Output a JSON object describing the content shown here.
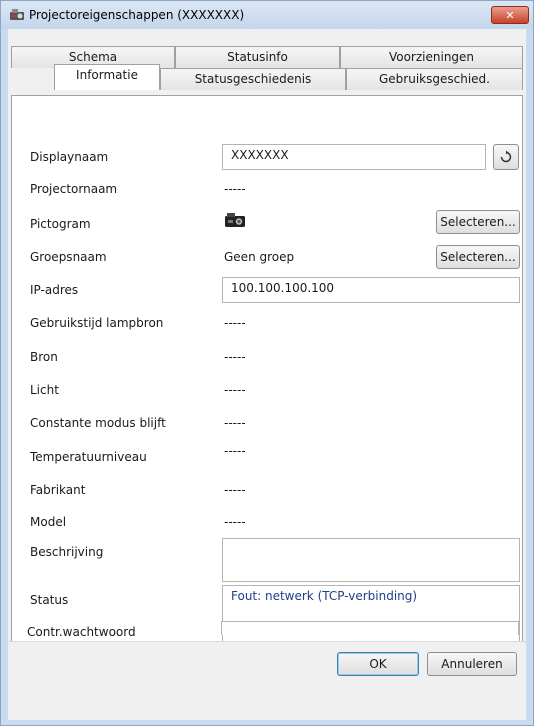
{
  "window": {
    "title": "Projectoreigenschappen (XXXXXXX)",
    "close_label": "✕"
  },
  "tabs_row1": [
    "Schema",
    "Statusinfo",
    "Voorzieningen"
  ],
  "tabs_row2": [
    "Informatie",
    "Statusgeschiedenis",
    "Gebruiksgeschied."
  ],
  "fields": {
    "displaynaam": {
      "label": "Displaynaam",
      "value": "XXXXXXX"
    },
    "projectornaam": {
      "label": "Projectornaam",
      "value": "-----"
    },
    "pictogram": {
      "label": "Pictogram",
      "button": "Selecteren..."
    },
    "groepsnaam": {
      "label": "Groepsnaam",
      "value": "Geen groep",
      "button": "Selecteren..."
    },
    "ip": {
      "label": "IP-adres",
      "value": "100.100.100.100"
    },
    "lamp": {
      "label": "Gebruikstijd lampbron",
      "value": "-----"
    },
    "bron": {
      "label": "Bron",
      "value": "-----"
    },
    "licht": {
      "label": "Licht",
      "value": "-----"
    },
    "constante": {
      "label": "Constante modus blijft",
      "value": "-----"
    },
    "temperatuur": {
      "label": "Temperatuurniveau",
      "value": "-----"
    },
    "fabrikant": {
      "label": "Fabrikant",
      "value": "-----"
    },
    "model": {
      "label": "Model",
      "value": "-----"
    },
    "beschrijving": {
      "label": "Beschrijving",
      "value": ""
    },
    "status": {
      "label": "Status",
      "value": "Fout: netwerk (TCP-verbinding)"
    },
    "wachtwoord": {
      "label": "Contr.wachtwoord",
      "value": ""
    }
  },
  "icons": {
    "refresh": "refresh-icon",
    "projector": "projector-icon",
    "app": "projector-app-icon"
  },
  "footer": {
    "ok_label": "OK",
    "cancel_label": "Annuleren"
  },
  "colors": {
    "status_text": "#1f3d8a",
    "close_button": "#c7412a"
  }
}
